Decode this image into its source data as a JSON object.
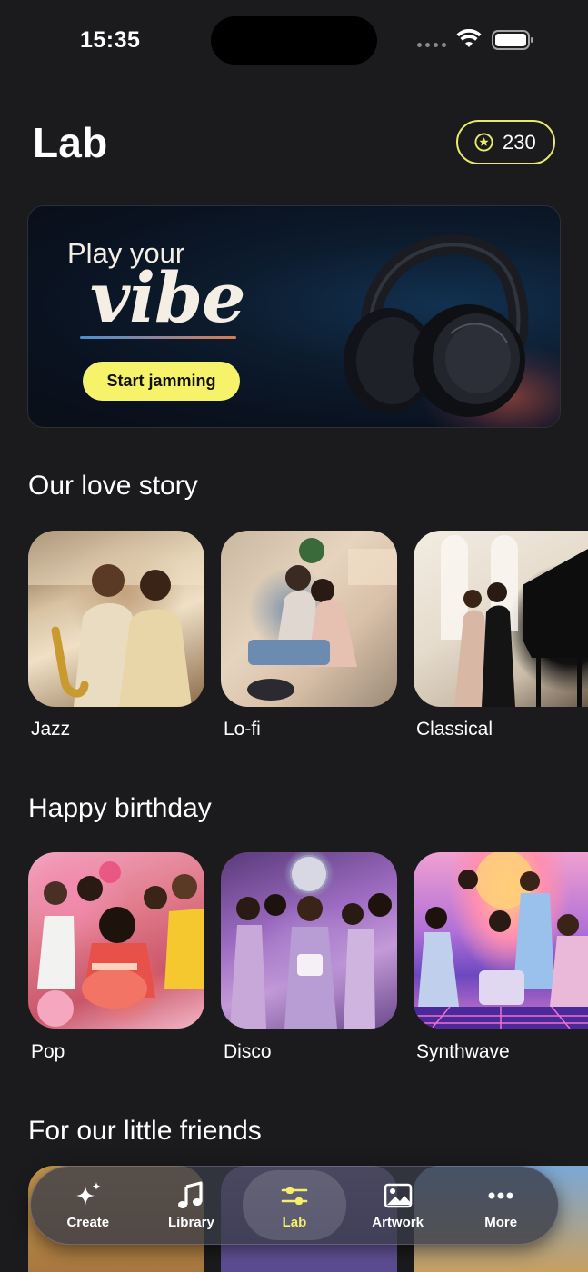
{
  "status_bar": {
    "time": "15:35"
  },
  "header": {
    "title": "Lab",
    "credits": "230"
  },
  "banner": {
    "line1": "Play your",
    "line2": "vibe",
    "cta": "Start jamming"
  },
  "sections": [
    {
      "title": "Our love story",
      "items": [
        {
          "label": "Jazz"
        },
        {
          "label": "Lo-fi"
        },
        {
          "label": "Classical"
        }
      ]
    },
    {
      "title": "Happy birthday",
      "items": [
        {
          "label": "Pop"
        },
        {
          "label": "Disco"
        },
        {
          "label": "Synthwave"
        }
      ]
    },
    {
      "title": "For our little friends",
      "items": []
    }
  ],
  "tab_bar": {
    "tabs": [
      {
        "label": "Create",
        "icon": "sparkles-icon"
      },
      {
        "label": "Library",
        "icon": "music-note-icon"
      },
      {
        "label": "Lab",
        "icon": "sliders-icon",
        "active": true
      },
      {
        "label": "Artwork",
        "icon": "image-icon"
      },
      {
        "label": "More",
        "icon": "more-dots-icon"
      }
    ]
  },
  "colors": {
    "accent": "#f6f36a",
    "background": "#1b1b1d",
    "pill_border": "#e9ea6a"
  }
}
